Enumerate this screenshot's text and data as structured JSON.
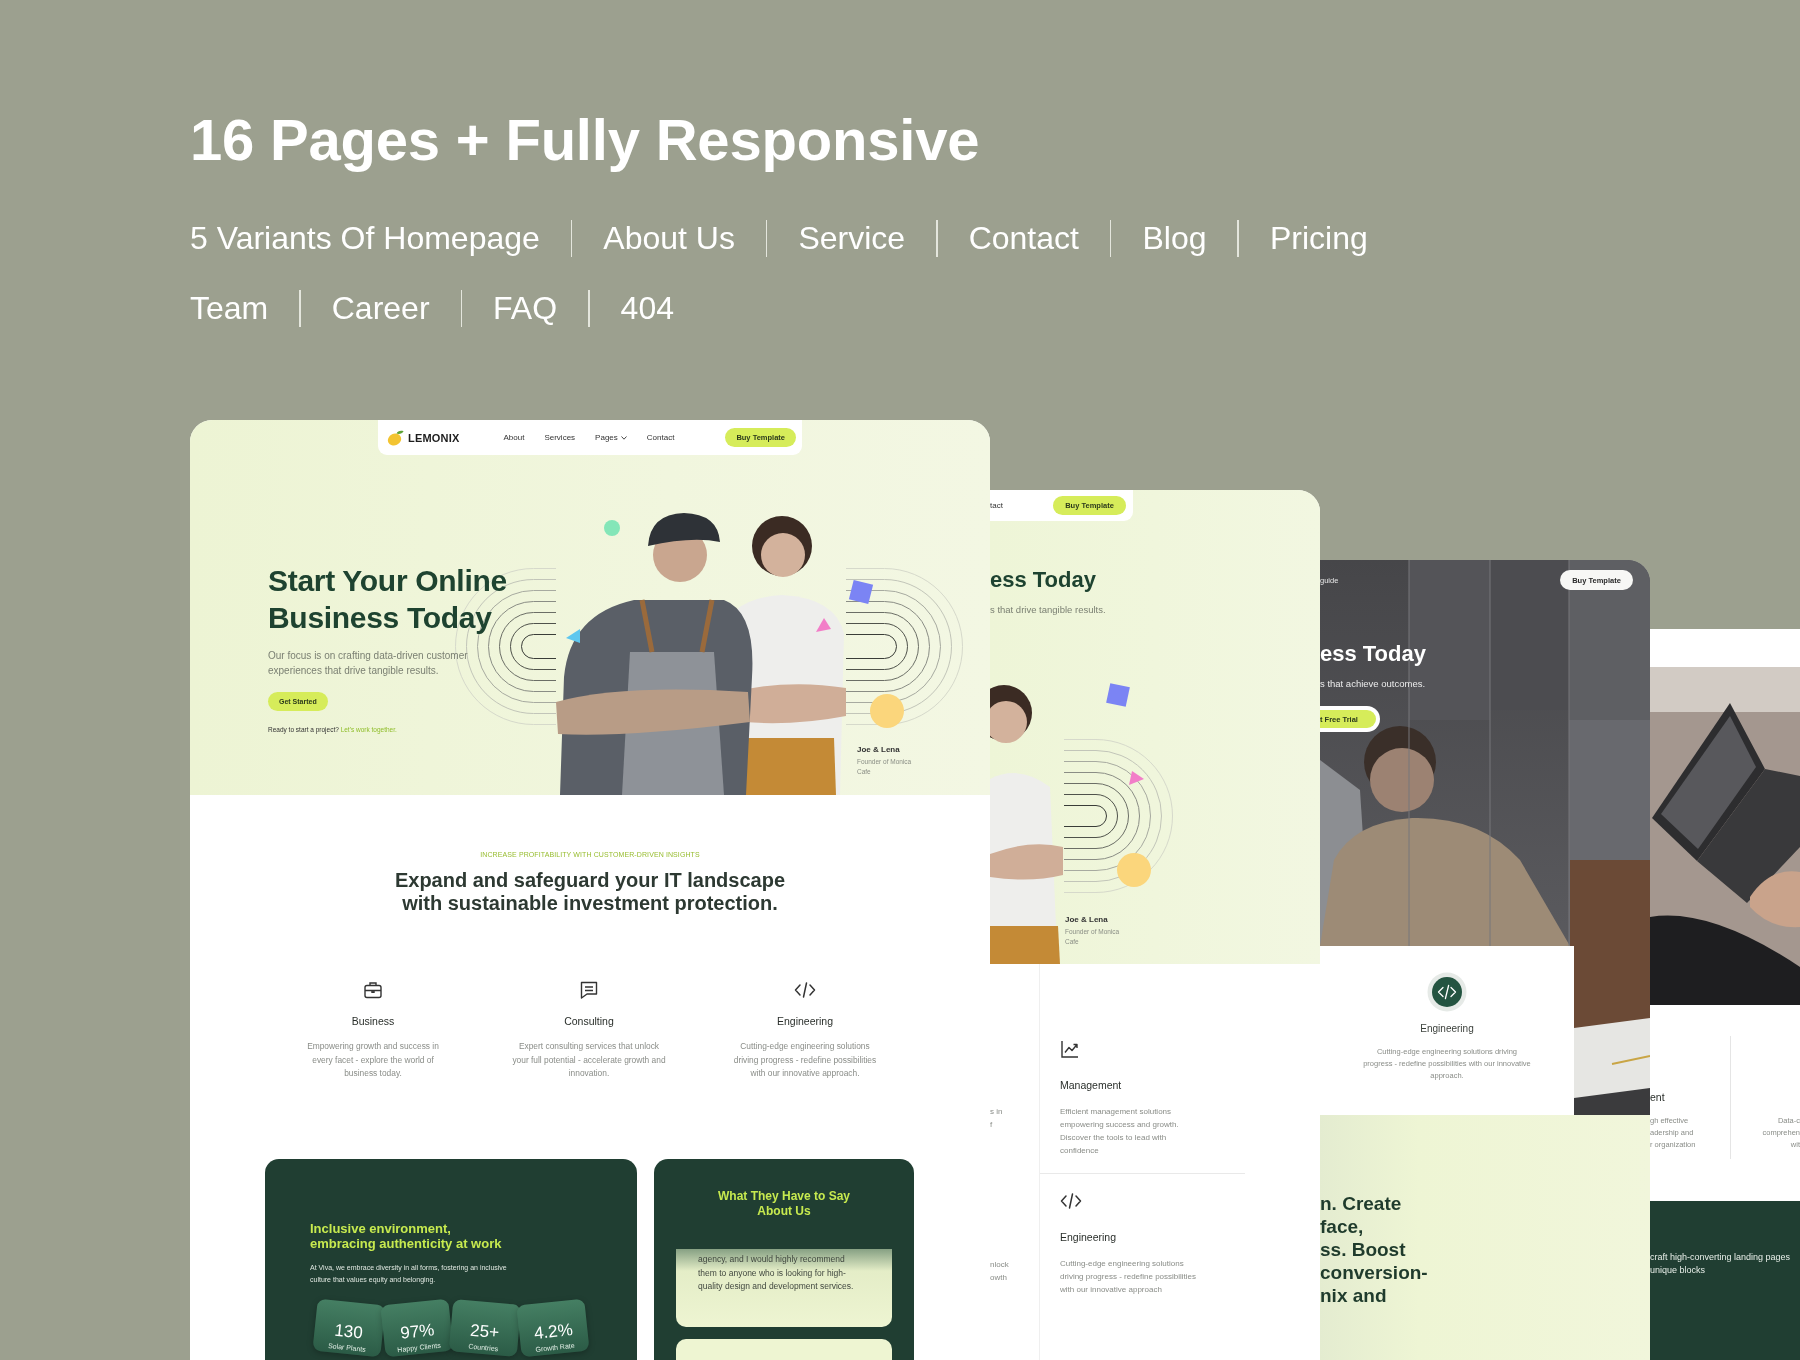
{
  "title": "16 Pages + Fully Responsive",
  "page_rows": [
    {
      "pages": [
        "5 Variants Of Homepage",
        "About Us",
        "Service",
        "Contact",
        "Blog",
        "Pricing"
      ]
    },
    {
      "pages": [
        "Team",
        "Career",
        "FAQ",
        "404"
      ]
    }
  ],
  "homepage_preview": {
    "nav": {
      "logo": "LEMONIX",
      "links": [
        {
          "label": "About",
          "dropdown": false
        },
        {
          "label": "Services",
          "dropdown": false
        },
        {
          "label": "Pages",
          "dropdown": true
        },
        {
          "label": "Contact",
          "dropdown": false
        }
      ],
      "button": "Buy Template"
    },
    "hero": {
      "title": "Start Your Online Business Today",
      "text": "Our focus is on crafting data-driven customer experiences that drive tangible results.",
      "button": "Get Started",
      "note": "Ready to start a project?",
      "note_link": "Let's work together.",
      "caption_name": "Joe & Lena",
      "caption_role": "Founder of Monica Cafe"
    },
    "intro": {
      "eyebrow": "INCREASE PROFITABILITY WITH CUSTOMER-DRIVEN INSIGHTS",
      "title": "Expand and safeguard your IT landscape with sustainable investment protection."
    },
    "services": [
      {
        "title": "Business",
        "text": "Empowering growth and success in every facet - explore the world of business today."
      },
      {
        "title": "Consulting",
        "text": "Expert consulting services that unlock your full potential - accelerate growth and innovation."
      },
      {
        "title": "Engineering",
        "text": "Cutting-edge engineering solutions driving progress - redefine possibilities with our innovative approach."
      }
    ],
    "culture": {
      "title": "Inclusive environment, embracing authenticity at work",
      "text": "At Viva, we embrace diversity in all forms, fostering an inclusive culture that values equity and belonging.",
      "stats": [
        {
          "value": "130",
          "label": "Solar Plants"
        },
        {
          "value": "97%",
          "label": "Happy Clients"
        },
        {
          "value": "25+",
          "label": "Countries"
        },
        {
          "value": "4.2%",
          "label": "Growth Rate"
        }
      ]
    },
    "testimonials": {
      "title": "What They Have to Say About Us",
      "quote": "agency, and I would highly recommend them to anyone who is looking for high-quality design and development services."
    }
  },
  "second_preview": {
    "nav_link": "tact",
    "button": "Buy Template",
    "title": "ess Today",
    "text": "s that drive tangible results.",
    "caption_name": "Joe & Lena",
    "caption_role": "Founder of Monica Cafe",
    "column_1": [
      {
        "lines": [
          "s in",
          "f"
        ]
      },
      {
        "lines": [
          "nlock",
          "owth"
        ]
      }
    ],
    "services": [
      {
        "title": "Management",
        "text": "Efficient management solutions empowering success and growth. Discover the tools to lead with confidence"
      },
      {
        "title": "Engineering",
        "text": "Cutting-edge engineering solutions driving progress - redefine possibilities with our innovative approach"
      }
    ]
  },
  "third_preview": {
    "nav_link": "guide",
    "button": "Buy Template",
    "title": "ess Today",
    "text": "s that achieve outcomes.",
    "button_2": "t Free Trial",
    "service": {
      "title": "Engineering",
      "text": "Cutting-edge engineering solutions driving progress - redefine possibilities with our innovative approach."
    },
    "banner_lines": [
      "n. Create",
      "face,",
      "ss. Boost",
      "conversion-",
      "nix and"
    ]
  },
  "fourth_preview": {
    "service_title": "ent",
    "service_lines": [
      "gh effective",
      "adership and",
      "r organization"
    ],
    "column_2_lines": [
      "Data-c",
      "comprehen",
      "wit"
    ],
    "banner_lines": [
      "craft high-converting landing pages",
      "unique blocks"
    ]
  }
}
